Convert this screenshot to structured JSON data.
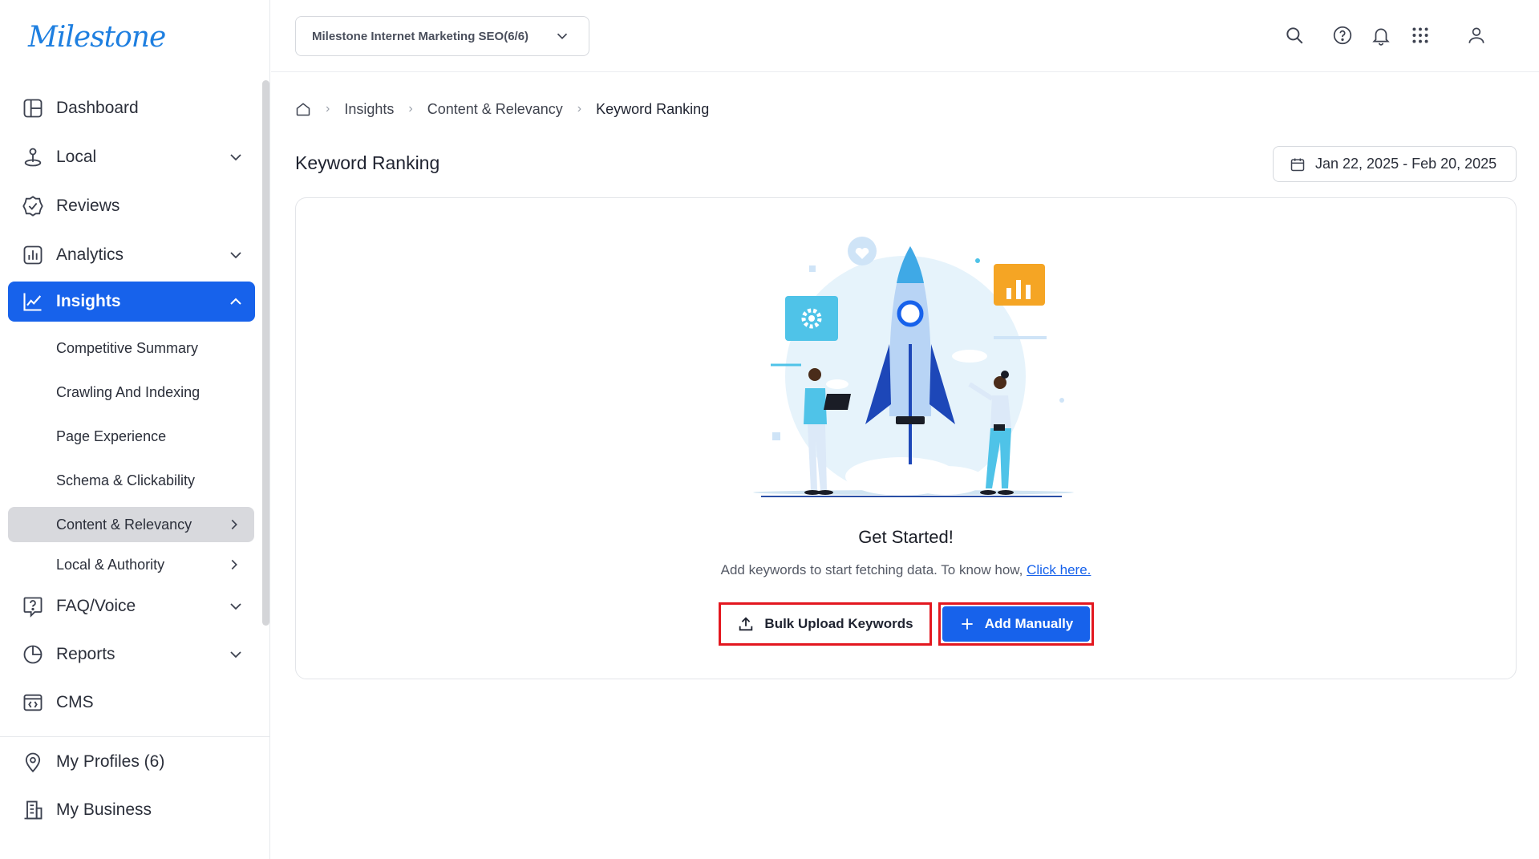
{
  "app": {
    "logo_text": "Milestone"
  },
  "sidebar": {
    "items": [
      {
        "label": "Dashboard",
        "icon": "dashboard-icon"
      },
      {
        "label": "Local",
        "icon": "location-pin-icon"
      },
      {
        "label": "Reviews",
        "icon": "badge-check-icon"
      },
      {
        "label": "Analytics",
        "icon": "bar-chart-icon"
      },
      {
        "label": "Insights",
        "icon": "line-chart-icon"
      },
      {
        "label": "FAQ/Voice",
        "icon": "question-bubble-icon"
      },
      {
        "label": "Reports",
        "icon": "pie-chart-icon"
      },
      {
        "label": "CMS",
        "icon": "code-window-icon"
      },
      {
        "label": "My Profiles (6)",
        "icon": "map-pin-icon"
      },
      {
        "label": "My Business",
        "icon": "building-icon"
      }
    ],
    "insights_sub": [
      {
        "label": "Competitive Summary"
      },
      {
        "label": "Crawling And Indexing"
      },
      {
        "label": "Page Experience"
      },
      {
        "label": "Schema & Clickability"
      },
      {
        "label": "Content & Relevancy"
      },
      {
        "label": "Local & Authority"
      }
    ]
  },
  "header": {
    "profile_selector": "Milestone Internet Marketing SEO(6/6)",
    "icons": [
      "search-icon",
      "help-icon",
      "bell-icon",
      "apps-grid-icon",
      "user-icon"
    ]
  },
  "breadcrumb": {
    "items": [
      "Insights",
      "Content & Relevancy",
      "Keyword Ranking"
    ]
  },
  "page": {
    "title": "Keyword Ranking",
    "date_range": "Jan 22, 2025 - Feb 20, 2025"
  },
  "empty_state": {
    "title": "Get Started!",
    "subtitle": "Add keywords to start fetching data. To know how,",
    "link": "Click here.",
    "bulk_upload_label": "Bulk Upload Keywords",
    "add_manually_label": "Add Manually"
  },
  "colors": {
    "accent": "#1762eb",
    "highlight_border": "#e3171f",
    "selected_bg": "#d8d9dd"
  }
}
